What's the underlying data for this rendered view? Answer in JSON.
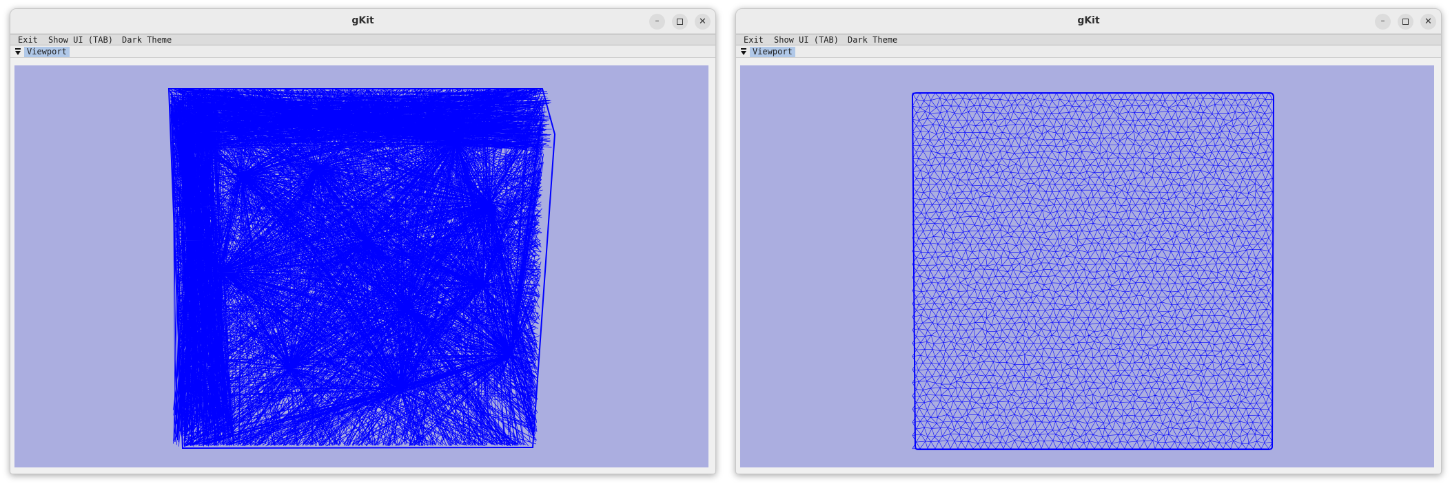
{
  "windows": [
    {
      "title": "gKit",
      "controls": {
        "minimize": "–",
        "maximize": "maximize-icon",
        "close": "✕"
      },
      "menu": {
        "exit": "Exit",
        "show_ui": "Show UI (TAB)",
        "dark_theme": "Dark Theme"
      },
      "panel": {
        "tab_label": "Viewport"
      },
      "viewport": {
        "mesh_style": "degenerate-fan",
        "mesh_color": "#0000ff",
        "background": "#abaee0"
      }
    },
    {
      "title": "gKit",
      "controls": {
        "minimize": "–",
        "maximize": "maximize-icon",
        "close": "✕"
      },
      "menu": {
        "exit": "Exit",
        "show_ui": "Show UI (TAB)",
        "dark_theme": "Dark Theme"
      },
      "panel": {
        "tab_label": "Viewport"
      },
      "viewport": {
        "mesh_style": "uniform-delaunay",
        "mesh_color": "#0000ff",
        "background": "#abaee0"
      }
    }
  ]
}
